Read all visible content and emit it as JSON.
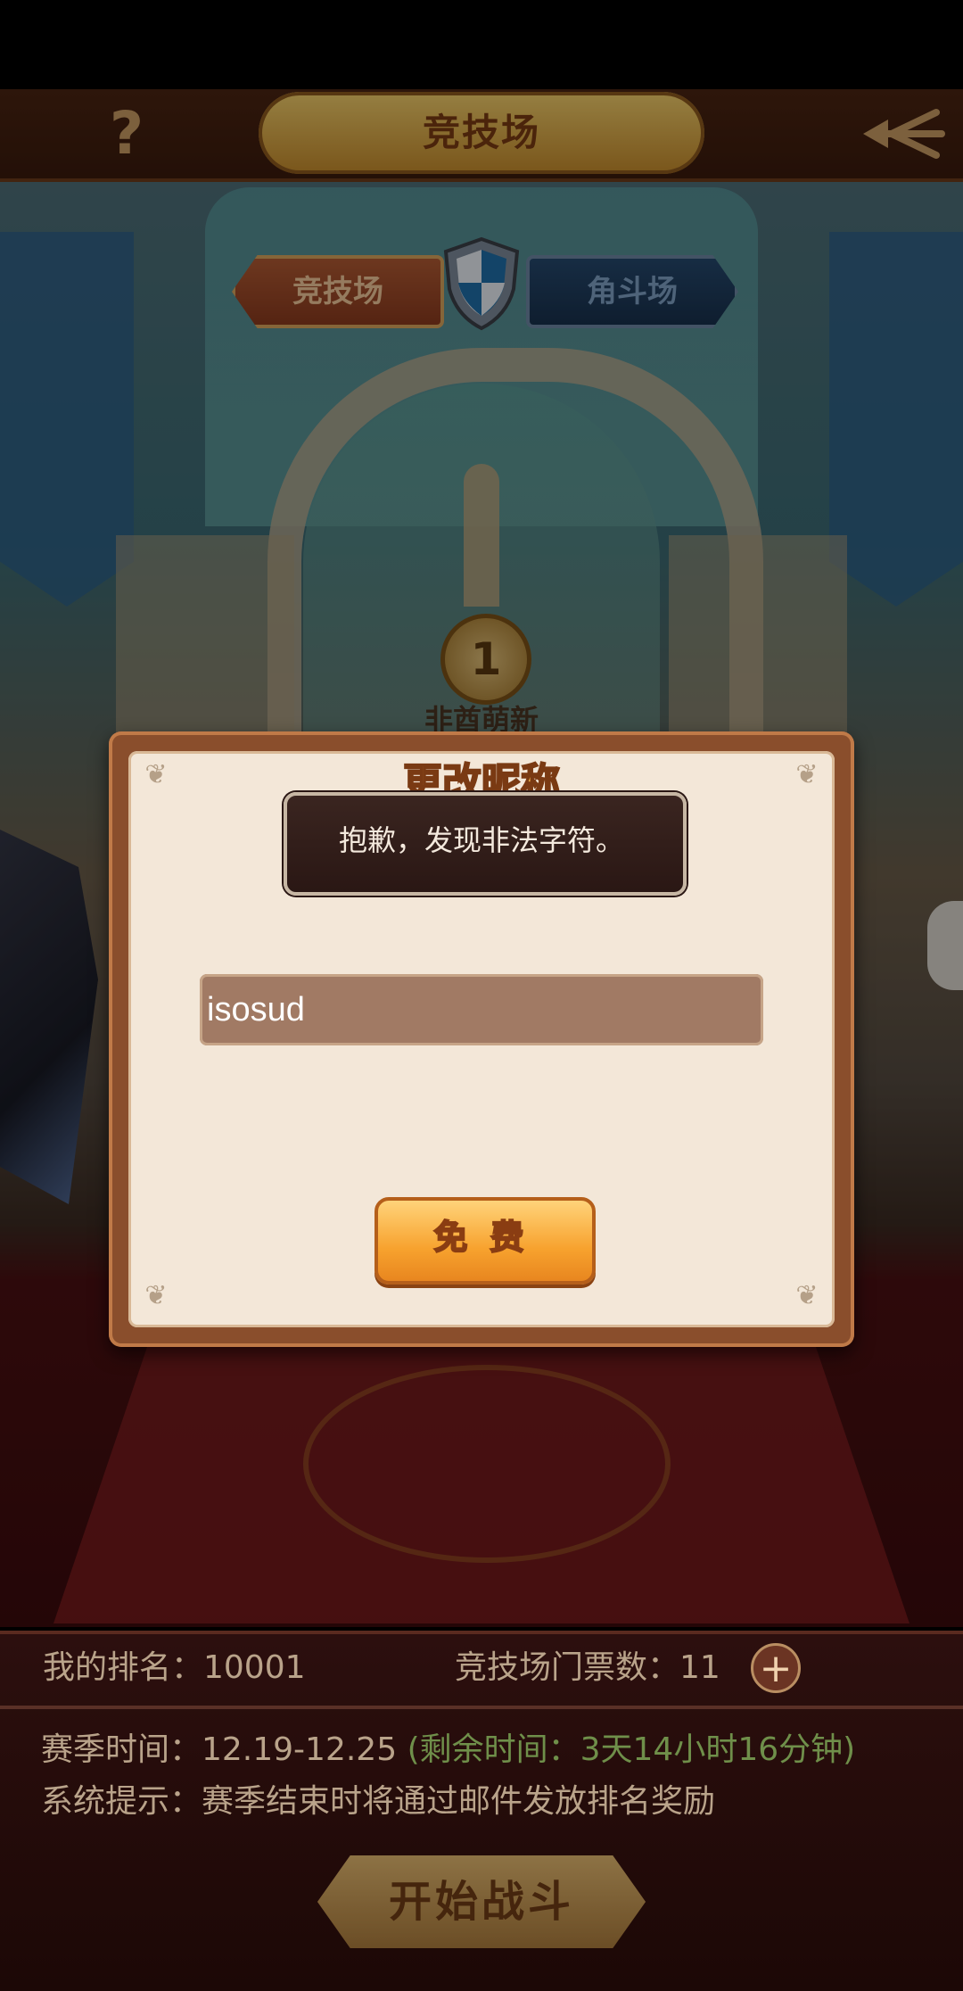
{
  "header": {
    "title": "竞技场",
    "help_label": "?",
    "back_icon": "back-arrow-icon"
  },
  "tabs": [
    {
      "label": "竞技场",
      "selected": true
    },
    {
      "label": "角斗场",
      "selected": false
    }
  ],
  "rank_badge": {
    "rank": "1",
    "player_name": "非酋萌新"
  },
  "dialog": {
    "title": "更改昵称",
    "toast": "抱歉，发现非法字符。",
    "name_value": "isosud",
    "button_label": "免 费"
  },
  "info": {
    "my_rank": "我的排名：10001",
    "ticket_count": "竞技场门票数：11",
    "add_label": "+",
    "season_time": "赛季时间：12.19-12.25 ",
    "season_remaining": "(剩余时间：3天14小时16分钟)",
    "system_hint": "系统提示：赛季结束时将通过邮件发放排名奖励"
  },
  "battle_button": "开始战斗",
  "colors": {
    "accent_gold": "#f0b349",
    "panel_bg": "#f3e7d8",
    "remaining_green": "#6f8f4a"
  }
}
